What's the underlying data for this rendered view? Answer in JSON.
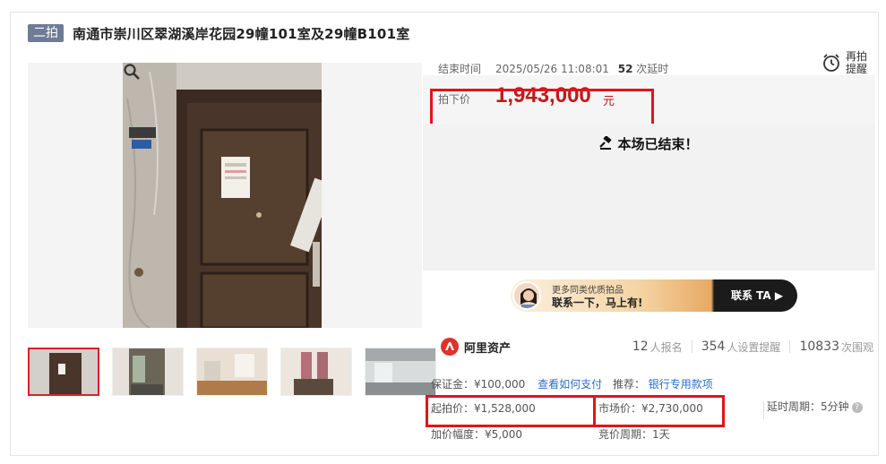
{
  "header": {
    "badge": "二拍",
    "title": "南通市崇川区翠湖溪岸花园29幢101室及29幢B101室"
  },
  "auction": {
    "end_label": "结束时间",
    "end_time": "2025/05/26 11:08:01",
    "delay_count": "52",
    "delay_suffix": "次延时",
    "remind_label": "再拍提醒",
    "price_label": "拍下价",
    "price_value": "1,943,000",
    "price_unit": "元",
    "ended_text": "本场已结束！"
  },
  "promo": {
    "small_text": "更多同类优质拍品",
    "big_text": "联系一下，马上有!",
    "button_text": "联系 TA ▶"
  },
  "stats": {
    "brand": "阿里资产",
    "signup_count": "12",
    "signup_label": "人报名",
    "reminder_count": "354",
    "reminder_label": "人设置提醒",
    "view_count": "10833",
    "view_label": "次围观"
  },
  "details": {
    "deposit": "保证金：¥100,000",
    "deposit_link": "查看如何支付",
    "recommend_label": "推荐：",
    "recommend_link": "银行专用款项",
    "start_price": "起拍价：¥1,528,000",
    "market_price": "市场价：¥2,730,000",
    "delay_period": "延时周期：5分钟",
    "increment": "加价幅度：¥5,000",
    "bid_period": "竞价周期：1天"
  },
  "colors": {
    "accent_red": "#c4161c",
    "highlight_box": "#e0141e",
    "link_blue": "#2b6fc1",
    "badge_bg": "#6e7c94"
  }
}
